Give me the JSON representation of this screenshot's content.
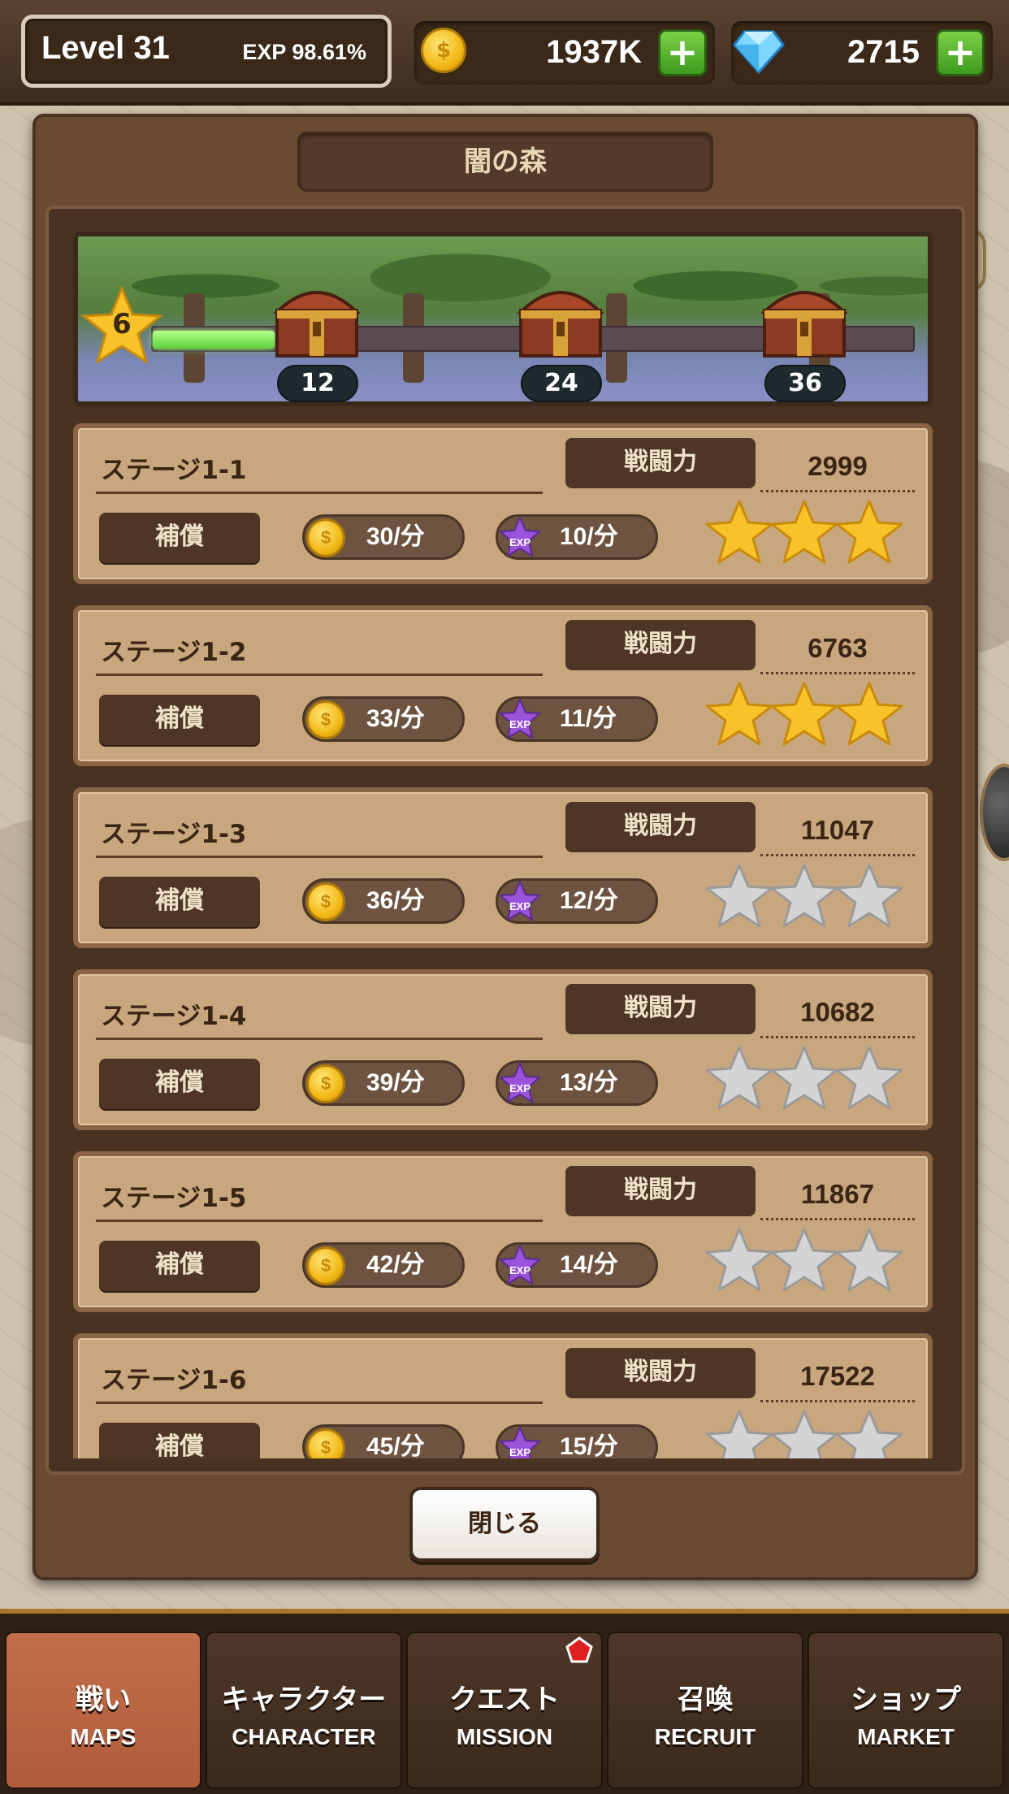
{
  "header": {
    "level": "Level 31",
    "exp": "EXP 98.61%",
    "coins": "1937K",
    "gems": "2715",
    "plus_symbol": "+"
  },
  "panel": {
    "title": "闇の森",
    "close_label": "閉じる"
  },
  "progress": {
    "star_count": "6",
    "fill_fraction": 0.16,
    "milestones": [
      "12",
      "24",
      "36"
    ]
  },
  "labels": {
    "power": "戦闘力",
    "reward": "補償"
  },
  "stages": [
    {
      "name": "ステージ1-1",
      "power": "2999",
      "coin_reward": "30/分",
      "exp_reward": "10/分",
      "stars_earned": 3
    },
    {
      "name": "ステージ1-2",
      "power": "6763",
      "coin_reward": "33/分",
      "exp_reward": "11/分",
      "stars_earned": 3
    },
    {
      "name": "ステージ1-3",
      "power": "11047",
      "coin_reward": "36/分",
      "exp_reward": "12/分",
      "stars_earned": 0
    },
    {
      "name": "ステージ1-4",
      "power": "10682",
      "coin_reward": "39/分",
      "exp_reward": "13/分",
      "stars_earned": 0
    },
    {
      "name": "ステージ1-5",
      "power": "11867",
      "coin_reward": "42/分",
      "exp_reward": "14/分",
      "stars_earned": 0
    },
    {
      "name": "ステージ1-6",
      "power": "17522",
      "coin_reward": "45/分",
      "exp_reward": "15/分",
      "stars_earned": 0
    }
  ],
  "nav": [
    {
      "jp": "戦い",
      "en": "MAPS",
      "active": true
    },
    {
      "jp": "キャラクター",
      "en": "CHARACTER",
      "active": false
    },
    {
      "jp": "クエスト",
      "en": "MISSION",
      "active": false
    },
    {
      "jp": "召喚",
      "en": "RECRUIT",
      "active": false
    },
    {
      "jp": "ショップ",
      "en": "MARKET",
      "active": false
    }
  ],
  "colors": {
    "star_gold": "#f7c22a",
    "star_grey": "#d4d4d4",
    "nav_active": "#c36e4a",
    "plus_green": "#5cb82e",
    "badge_red": "#e02020"
  }
}
